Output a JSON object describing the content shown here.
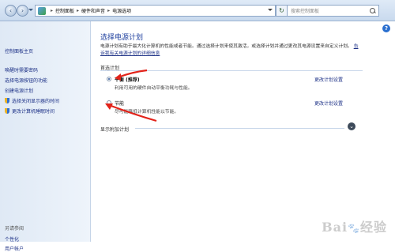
{
  "address": {
    "segments": [
      "控制面板",
      "硬件和声音",
      "电源选项"
    ]
  },
  "search": {
    "placeholder": "搜索控制面板"
  },
  "sidebar": {
    "home": "控制面板主页",
    "links": [
      "唤醒时需要密码",
      "选择电源按钮的功能",
      "创建电源计划",
      "选择关闭显示器的时间",
      "更改计算机睡眠时间"
    ],
    "see_also_label": "另请参阅",
    "see_also": [
      "个性化",
      "用户帐户"
    ]
  },
  "main": {
    "title": "选择电源计划",
    "description": "电源计划有助于最大化计算机的性能或者节能。通过选择计划来使其激活，或选择计划并通过更改其电源设置来自定义计划。",
    "link": "告诉我有关电源计划的详细信息",
    "preferred_label": "首选计划",
    "plans": [
      {
        "name": "平衡 (推荐)",
        "desc": "利用可用的硬件自动平衡功耗与性能。",
        "link": "更改计划设置",
        "selected": true
      },
      {
        "name": "节能",
        "desc": "尽可能降低计算机性能以节能。",
        "link": "更改计划设置",
        "selected": false
      }
    ],
    "extra_label": "显示附加计划"
  },
  "watermark": "Bai🐾经验"
}
